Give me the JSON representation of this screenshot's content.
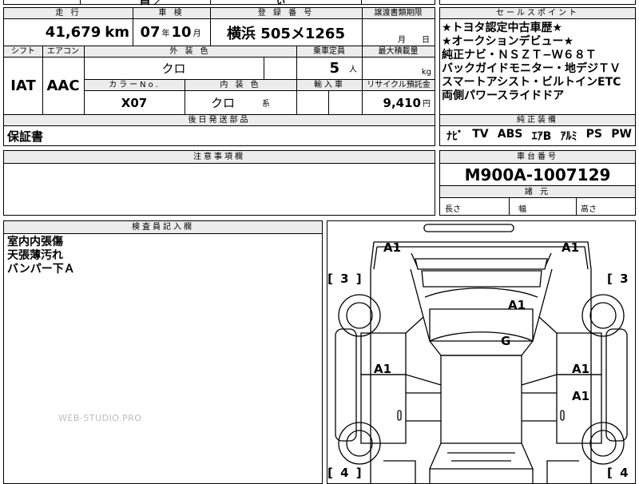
{
  "top_strip": {
    "cut_text_left": "昌 ／",
    "cut_text_right": "ぃ"
  },
  "headers": {
    "mileage": "走 行",
    "inspection": "車 検",
    "registration": "登 録 番 号",
    "transfer_deadline": "譲渡書類期限",
    "sales_point": "セールスポイント",
    "shift": "シフト",
    "aircon": "エアコン",
    "exterior_color": "外 装 色",
    "capacity": "乗車定員",
    "max_load": "最大積載量",
    "color_no": "カラーNo.",
    "interior_color": "内 装 色",
    "import": "輸入車",
    "recycle": "リサイクル預託金",
    "later_parts": "後日発送部品",
    "standard_equipment": "純正装備",
    "notes": "注意事項欄",
    "chassis_no": "車台番号",
    "specs": "諸 元",
    "inspector_notes": "検査員記入欄"
  },
  "vehicle": {
    "mileage_value": "41,679",
    "mileage_unit": "km",
    "inspection_year": "07",
    "inspection_year_unit": "年",
    "inspection_month": "10",
    "inspection_month_unit": "月",
    "registration_value": "横浜 505メ1265",
    "transfer_month_unit": "月",
    "transfer_day_unit": "日",
    "shift_value": "IAT",
    "aircon_value": "AAC",
    "exterior_color_value": "クロ",
    "capacity_value": "5",
    "capacity_unit": "人",
    "max_load_unit": "kg",
    "color_no_value": "X07",
    "interior_color_value": "クロ",
    "interior_color_suffix": "系",
    "recycle_value": "9,410",
    "recycle_unit": "円",
    "later_parts_value": "保証書",
    "chassis_no_value": "M900A-1007129"
  },
  "sales_points": [
    "★トヨタ認定中古車歴★",
    "★オークションデビュー★",
    "純正ナビ・ＮＳＺＴ−Ｗ６８Ｔ",
    "バックガイドモニター・地デジＴＶ",
    "スマートアシスト・ビルトインETC",
    "両側パワースライドドア"
  ],
  "equipment": [
    "ﾅﾋﾞ",
    "TV",
    "ABS",
    "ｴｱB",
    "ｱﾙﾐ",
    "PS",
    "PW"
  ],
  "specs_labels": {
    "length": "長さ",
    "width": "幅",
    "height": "高さ"
  },
  "inspector_notes": [
    "室内内張傷",
    "天張薄汚れ",
    "バンパー下Ａ"
  ],
  "watermark": "WEB-STUDIO.PRO",
  "diagram": {
    "marks": {
      "front_left": "A1",
      "front_right": "A1",
      "roof": "A1",
      "glass": "G",
      "left_door": "A1",
      "right_front_door": "A1",
      "right_rear_door": "A1"
    },
    "tire_front_left": "[ 3 ]",
    "tire_front_right": "[ 3",
    "tire_rear_left": "[ 4 ]",
    "tire_rear_right": "[ 4"
  }
}
